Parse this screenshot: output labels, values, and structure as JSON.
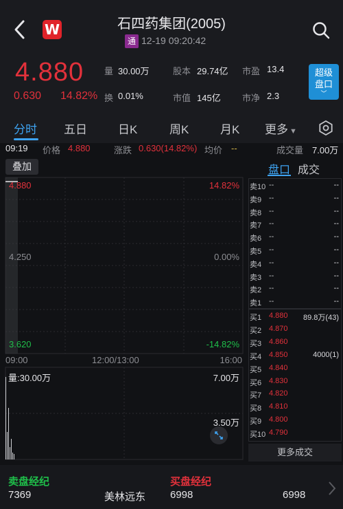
{
  "header": {
    "logo_text": "W",
    "title": "石四药集团(2005)",
    "badge": "通",
    "timestamp": "12-19 09:20:42"
  },
  "quote": {
    "price": "4.880",
    "change": "0.630",
    "change_pct": "14.82%",
    "stats": [
      {
        "label": "量",
        "value": "30.00万"
      },
      {
        "label": "股本",
        "value": "29.74亿"
      },
      {
        "label": "市盈",
        "value": "13.4"
      },
      {
        "label": "换",
        "value": "0.01%"
      },
      {
        "label": "市值",
        "value": "145亿"
      },
      {
        "label": "市净",
        "value": "2.3"
      }
    ],
    "super_button_line1": "超级",
    "super_button_line2": "盘口"
  },
  "tabs": [
    {
      "label": "分时",
      "active": true
    },
    {
      "label": "五日"
    },
    {
      "label": "日K"
    },
    {
      "label": "周K"
    },
    {
      "label": "月K"
    },
    {
      "label": "更多"
    }
  ],
  "info_row": {
    "time": "09:19",
    "price_label": "价格",
    "price_value": "4.880",
    "change_label": "涨跌",
    "change_value": "0.630(14.82%)",
    "avg_label": "均价",
    "avg_value": "--",
    "volume_label": "成交量",
    "volume_value": "7.00万"
  },
  "chart": {
    "overlay_label": "叠加",
    "y_top": "4.880",
    "y_mid": "4.250",
    "y_bottom": "3.620",
    "pct_top": "14.82%",
    "pct_mid": "0.00%",
    "pct_bottom": "-14.82%",
    "x_start": "09:00",
    "x_mid": "12:00/13:00",
    "x_end": "16:00",
    "volume_label": "量:30.00万",
    "vol_top": "7.00万",
    "vol_mid": "3.50万"
  },
  "order_book": {
    "tab_active": "盘口",
    "tab_other": "成交",
    "asks": [
      {
        "label": "卖10",
        "price": "--",
        "vol": "--"
      },
      {
        "label": "卖9",
        "price": "--",
        "vol": "--"
      },
      {
        "label": "卖8",
        "price": "--",
        "vol": "--"
      },
      {
        "label": "卖7",
        "price": "--",
        "vol": "--"
      },
      {
        "label": "卖6",
        "price": "--",
        "vol": "--"
      },
      {
        "label": "卖5",
        "price": "--",
        "vol": "--"
      },
      {
        "label": "卖4",
        "price": "--",
        "vol": "--"
      },
      {
        "label": "卖3",
        "price": "--",
        "vol": "--"
      },
      {
        "label": "卖2",
        "price": "--",
        "vol": "--"
      },
      {
        "label": "卖1",
        "price": "--",
        "vol": "--"
      }
    ],
    "bids": [
      {
        "label": "买1",
        "price": "4.880",
        "vol": "89.8万(43)"
      },
      {
        "label": "买2",
        "price": "4.870",
        "vol": ""
      },
      {
        "label": "买3",
        "price": "4.860",
        "vol": ""
      },
      {
        "label": "买4",
        "price": "4.850",
        "vol": "4000(1)"
      },
      {
        "label": "买5",
        "price": "4.840",
        "vol": ""
      },
      {
        "label": "买6",
        "price": "4.830",
        "vol": ""
      },
      {
        "label": "买7",
        "price": "4.820",
        "vol": ""
      },
      {
        "label": "买8",
        "price": "4.810",
        "vol": ""
      },
      {
        "label": "买9",
        "price": "4.800",
        "vol": ""
      },
      {
        "label": "买10",
        "price": "4.790",
        "vol": ""
      }
    ],
    "more_label": "更多成交"
  },
  "brokers": {
    "sell_title": "卖盘经纪",
    "buy_title": "买盘经纪",
    "sell_id": "7369",
    "sell_name": "美林远东",
    "buy_id": "6998",
    "buy_id2": "6998"
  },
  "colors": {
    "up": "#e2313b",
    "down": "#1fbf4a",
    "accent": "#3ea3f1",
    "background": "#111215"
  }
}
